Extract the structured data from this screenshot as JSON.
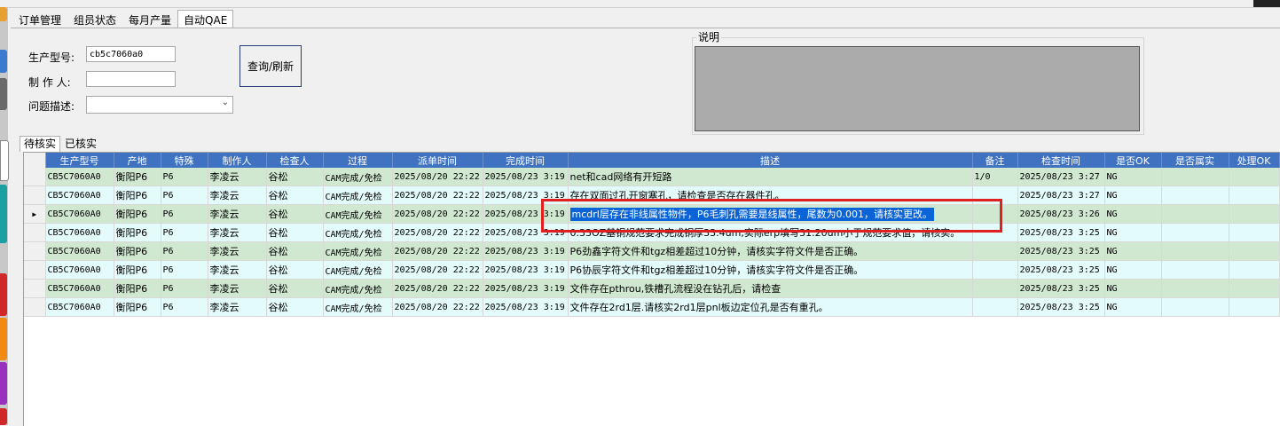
{
  "main_tabs": [
    "订单管理",
    "组员状态",
    "每月产量",
    "自动QAE"
  ],
  "form": {
    "model_label": "生产型号:",
    "model_value": "cb5c7060a0",
    "maker_label": "制 作 人:",
    "maker_value": "",
    "issue_label": "问题描述:",
    "issue_value": "",
    "query_button": "查询/刷新"
  },
  "description_label": "说明",
  "sub_tabs": [
    "待核实",
    "已核实"
  ],
  "columns": [
    "生产型号",
    "产地",
    "特殊",
    "制作人",
    "检查人",
    "过程",
    "派单时间",
    "完成时间",
    "描述",
    "备注",
    "检查时间",
    "是否OK",
    "是否属实",
    "处理OK"
  ],
  "rows": [
    [
      "CB5C7060A0",
      "衡阳P6",
      "P6",
      "李凌云",
      "谷松",
      "CAM完成/免检",
      "2025/08/20 22:22",
      "2025/08/23 3:19",
      "net和cad网络有开短路",
      "1/0",
      "2025/08/23 3:27",
      "NG",
      "",
      ""
    ],
    [
      "CB5C7060A0",
      "衡阳P6",
      "P6",
      "李凌云",
      "谷松",
      "CAM完成/免检",
      "2025/08/20 22:22",
      "2025/08/23 3:19",
      "存在双面过孔开窗塞孔，请检查是否存在器件孔。",
      "",
      "2025/08/23 3:27",
      "NG",
      "",
      ""
    ],
    [
      "CB5C7060A0",
      "衡阳P6",
      "P6",
      "李凌云",
      "谷松",
      "CAM完成/免检",
      "2025/08/20 22:22",
      "2025/08/23 3:19",
      "mcdrl层存在非线属性物件，P6毛刺孔需要是线属性，尾数为0.001，请核实更改。",
      "",
      "2025/08/23 3:26",
      "NG",
      "",
      ""
    ],
    [
      "CB5C7060A0",
      "衡阳P6",
      "P6",
      "李凌云",
      "谷松",
      "CAM完成/免检",
      "2025/08/20 22:22",
      "2025/08/23 3:19",
      "0.33OZ基铜规范要求完成铜厚33.4um,实际erp填写31.20um小于规范要求值，请核实。",
      "",
      "2025/08/23 3:25",
      "NG",
      "",
      ""
    ],
    [
      "CB5C7060A0",
      "衡阳P6",
      "P6",
      "李凌云",
      "谷松",
      "CAM完成/免检",
      "2025/08/20 22:22",
      "2025/08/23 3:19",
      "P6劲鑫字符文件和tgz相差超过10分钟，请核实字符文件是否正确。",
      "",
      "2025/08/23 3:25",
      "NG",
      "",
      ""
    ],
    [
      "CB5C7060A0",
      "衡阳P6",
      "P6",
      "李凌云",
      "谷松",
      "CAM完成/免检",
      "2025/08/20 22:22",
      "2025/08/23 3:19",
      "P6协辰字符文件和tgz相差超过10分钟，请核实字符文件是否正确。",
      "",
      "2025/08/23 3:25",
      "NG",
      "",
      ""
    ],
    [
      "CB5C7060A0",
      "衡阳P6",
      "P6",
      "李凌云",
      "谷松",
      "CAM完成/免检",
      "2025/08/20 22:22",
      "2025/08/23 3:19",
      "文件存在pthrou,铁槽孔流程没在钻孔后，请检查",
      "",
      "2025/08/23 3:25",
      "NG",
      "",
      ""
    ],
    [
      "CB5C7060A0",
      "衡阳P6",
      "P6",
      "李凌云",
      "谷松",
      "CAM完成/免检",
      "2025/08/20 22:22",
      "2025/08/23 3:19",
      "文件存在2rd1层.请核实2rd1层pnl板边定位孔是否有重孔。",
      "",
      "2025/08/23 3:25",
      "NG",
      "",
      ""
    ]
  ],
  "selected_row": 2,
  "colors": {
    "header": "#3f72c0",
    "row_even": "#cfe8cf",
    "row_odd": "#e4fbfb",
    "selection": "#0a64d8",
    "highlight_box": "#e02020"
  }
}
